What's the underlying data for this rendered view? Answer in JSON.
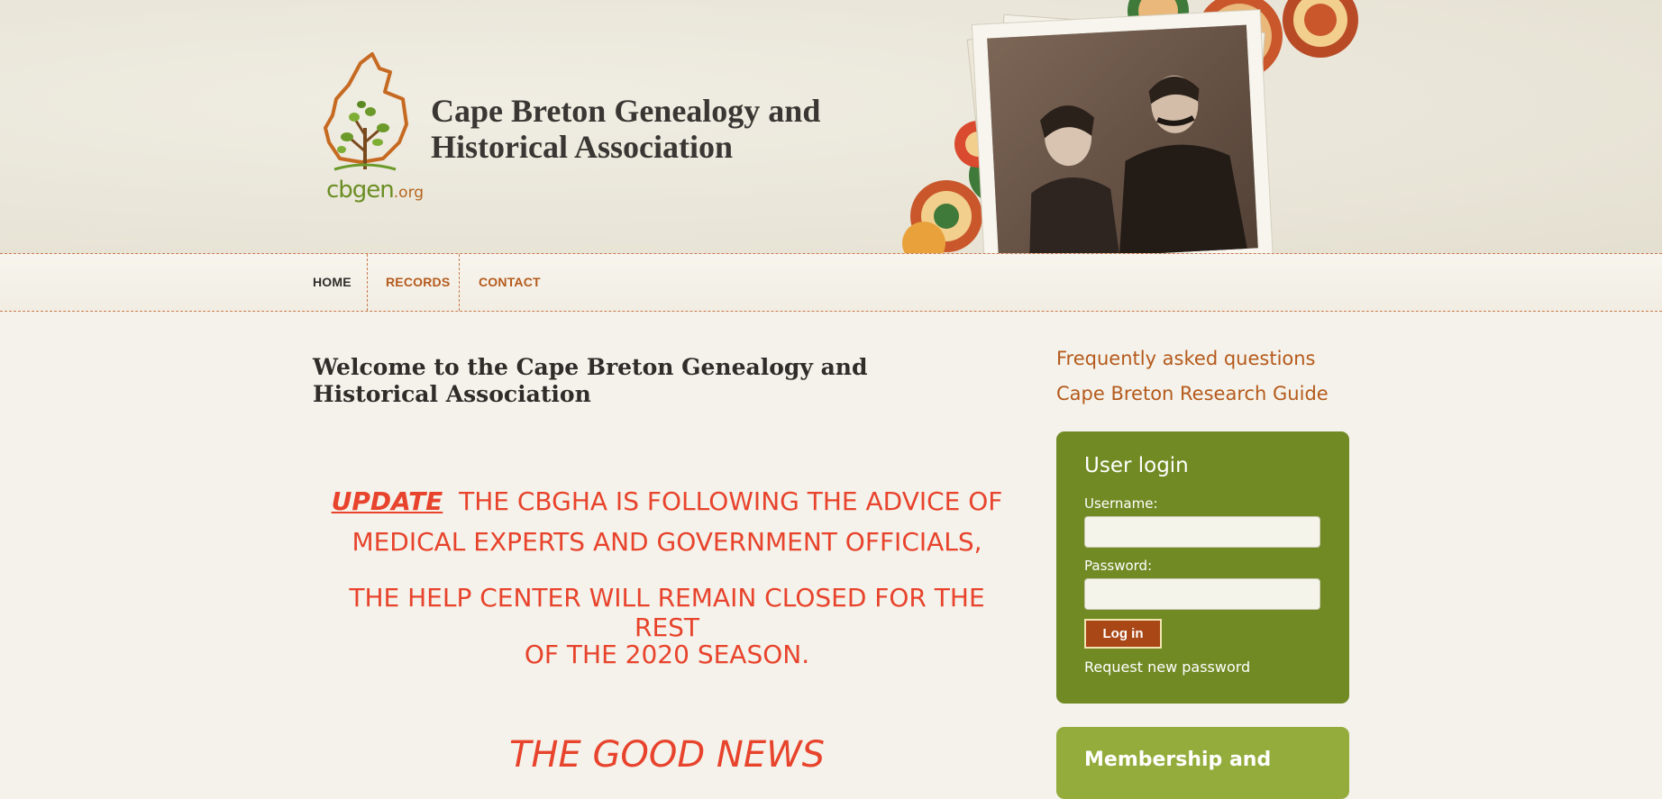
{
  "header": {
    "logo_text": "cbgen",
    "logo_suffix": ".org",
    "site_name_line1": "Cape Breton Genealogy and",
    "site_name_line2": "Historical Association"
  },
  "nav": {
    "items": [
      {
        "label": "HOME",
        "active": true
      },
      {
        "label": "RECORDS",
        "active": false
      },
      {
        "label": "CONTACT",
        "active": false
      }
    ]
  },
  "main": {
    "page_title": "Welcome to the Cape Breton Genealogy and Historical Association",
    "notice": {
      "update_label": "UPDATE",
      "line1": "THE CBGHA IS FOLLOWING THE ADVICE OF",
      "line2": "MEDICAL EXPERTS AND GOVERNMENT OFFICIALS,",
      "line3": "THE HELP CENTER WILL REMAIN CLOSED FOR THE REST",
      "line4": "OF THE 2020 SEASON."
    },
    "good_news": "THE GOOD NEWS"
  },
  "sidebar": {
    "links": [
      {
        "label": "Frequently asked questions"
      },
      {
        "label": "Cape Breton Research Guide"
      }
    ],
    "login": {
      "title": "User login",
      "username_label": "Username:",
      "username_value": "",
      "password_label": "Password:",
      "password_value": "",
      "button_label": "Log in",
      "request_password": "Request new password"
    },
    "membership_title": "Membership and"
  },
  "colors": {
    "accent_orange": "#b55a1c",
    "notice_red": "#e8432c",
    "login_green": "#718a24",
    "membership_green": "#93ac3b",
    "button_brown": "#a94716"
  },
  "icons": {
    "logo": "cape-breton-tree-logo",
    "header_image": "vintage-couple-photo"
  }
}
